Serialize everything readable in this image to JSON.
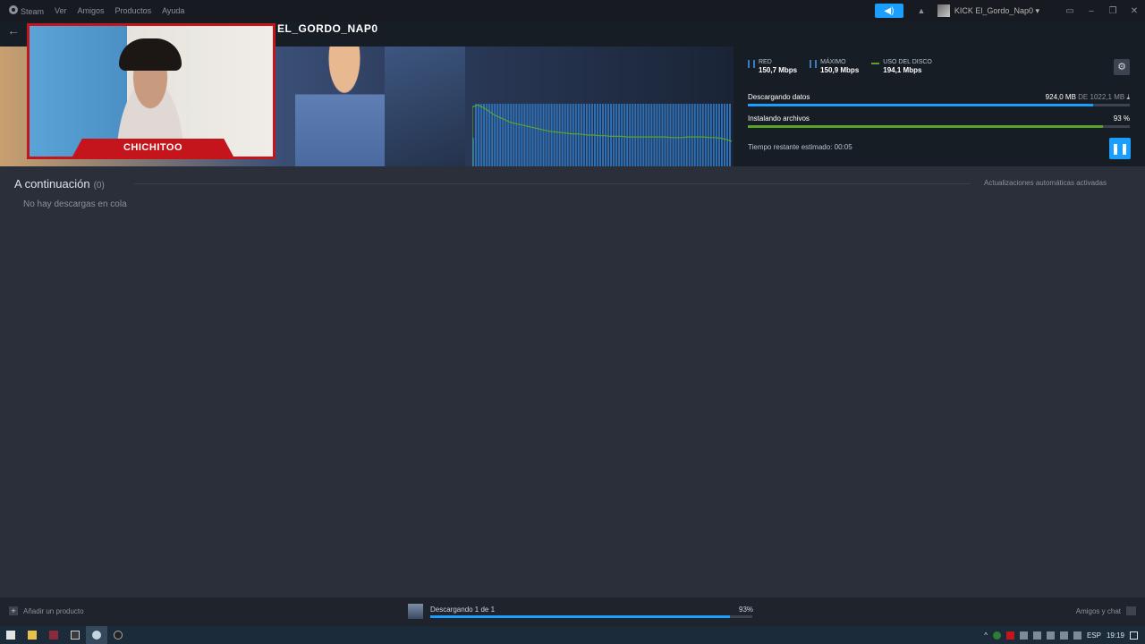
{
  "menu": {
    "app_name": "Steam",
    "items": [
      "Ver",
      "Amigos",
      "Productos",
      "Ayuda"
    ]
  },
  "user": {
    "name": "KICK El_Gordo_Nap0"
  },
  "game": {
    "title": "EL_GORDO_NAP0"
  },
  "webcam": {
    "label": "CHICHITOO"
  },
  "stats": {
    "network": {
      "label": "RED",
      "value": "150,7 Mbps"
    },
    "peak": {
      "label": "MÁXIMO",
      "value": "150,9 Mbps"
    },
    "disk": {
      "label": "USO DEL DISCO",
      "value": "194,1 Mbps"
    }
  },
  "download": {
    "label": "Descargando datos",
    "current": "924,0 MB",
    "of": "DE",
    "total": "1022,1 MB",
    "progress": 0.904
  },
  "install": {
    "label": "Instalando archivos",
    "percent_text": "93 %",
    "progress": 0.93
  },
  "time_remaining": "Tiempo restante estimado: 00:05",
  "queue": {
    "title": "A continuación",
    "count": "(0)",
    "empty_message": "No hay descargas en cola",
    "auto_updates": "Actualizaciones automáticas activadas"
  },
  "footer": {
    "add_product": "Añadir un producto",
    "status": "Descargando 1 de 1",
    "percent": "93%",
    "progress": 0.93,
    "friends_chat": "Amigos y chat"
  },
  "taskbar": {
    "language": "ESP",
    "time": "19:19"
  },
  "colors": {
    "accent": "#1a9fff",
    "install_bar": "#5ba32b",
    "webcam_frame": "#c4151c"
  },
  "graph": {
    "bars": [
      30,
      66,
      66,
      66,
      66,
      66,
      66,
      66,
      66,
      66,
      66,
      66,
      66,
      66,
      66,
      66,
      66,
      66,
      66,
      66,
      66,
      66,
      66,
      66,
      66,
      66,
      66,
      66,
      66,
      66,
      66,
      66,
      66,
      66,
      66,
      66,
      66,
      66,
      66,
      66,
      66,
      66,
      66,
      66,
      66,
      66,
      66,
      66,
      66,
      66,
      66,
      66,
      66,
      66,
      66,
      66,
      66,
      66,
      66,
      66,
      66,
      66,
      66,
      66,
      66,
      66,
      66,
      66,
      66,
      66,
      66,
      66,
      66,
      66,
      66,
      66,
      66,
      66,
      66,
      66,
      66,
      66,
      66,
      66,
      66,
      66,
      66,
      66,
      66,
      66,
      66,
      66,
      66,
      66,
      66,
      66
    ],
    "line": [
      0.05,
      0.02,
      0.06,
      0.12,
      0.18,
      0.22,
      0.26,
      0.3,
      0.32,
      0.34,
      0.36,
      0.38,
      0.4,
      0.42,
      0.44,
      0.45,
      0.46,
      0.47,
      0.48,
      0.48,
      0.49,
      0.5,
      0.5,
      0.51,
      0.51,
      0.52,
      0.52,
      0.52,
      0.53,
      0.53,
      0.53,
      0.53,
      0.53,
      0.53,
      0.53,
      0.53,
      0.54,
      0.54,
      0.54,
      0.53,
      0.53,
      0.53,
      0.53,
      0.54,
      0.54,
      0.55,
      0.57,
      0.6
    ]
  }
}
